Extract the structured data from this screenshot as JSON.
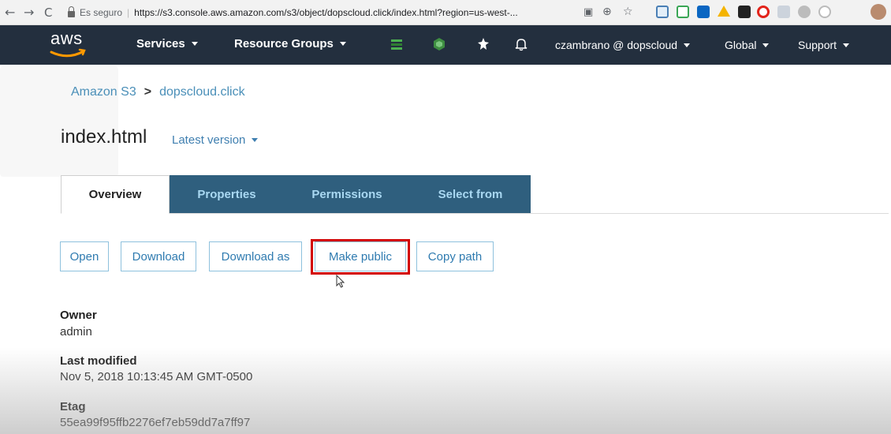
{
  "browser": {
    "secure_label": "Es seguro",
    "url": "https://s3.console.aws.amazon.com/s3/object/dopscloud.click/index.html?region=us-west-...",
    "icons": [
      "back-arrow",
      "forward-arrow",
      "reload",
      "lock",
      "translate",
      "zoom",
      "star",
      "extension-icons",
      "profile-avatar"
    ]
  },
  "topnav": {
    "logo": "aws",
    "services": "Services",
    "resource_groups": "Resource Groups",
    "user": "czambrano @ dopscloud",
    "region": "Global",
    "support": "Support",
    "icons": [
      "layers-green-icon",
      "box-green-icon",
      "pin-icon",
      "bell-icon"
    ],
    "bg_color": "#232f3e"
  },
  "breadcrumb": {
    "root": "Amazon S3",
    "separator": ">",
    "bucket": "dopscloud.click"
  },
  "object": {
    "name": "index.html",
    "version_label": "Latest version"
  },
  "tabs": [
    {
      "label": "Overview",
      "active": true
    },
    {
      "label": "Properties",
      "active": false
    },
    {
      "label": "Permissions",
      "active": false
    },
    {
      "label": "Select from",
      "active": false
    }
  ],
  "actions": {
    "open": "Open",
    "download": "Download",
    "download_as": "Download as",
    "make_public": "Make public",
    "copy_path": "Copy path"
  },
  "details": {
    "owner_label": "Owner",
    "owner_value": "admin",
    "modified_label": "Last modified",
    "modified_value": "Nov 5, 2018 10:13:45 AM GMT-0500",
    "etag_label": "Etag",
    "etag_value": "55ea99f95ffb2276ef7eb59dd7a7ff97"
  },
  "colors": {
    "link": "#3f7fb0",
    "tab_inactive_bg": "#2f5f7e",
    "tab_inactive_text": "#a9d8f2",
    "highlight": "#d30000",
    "aws_orange": "#ff9900"
  }
}
